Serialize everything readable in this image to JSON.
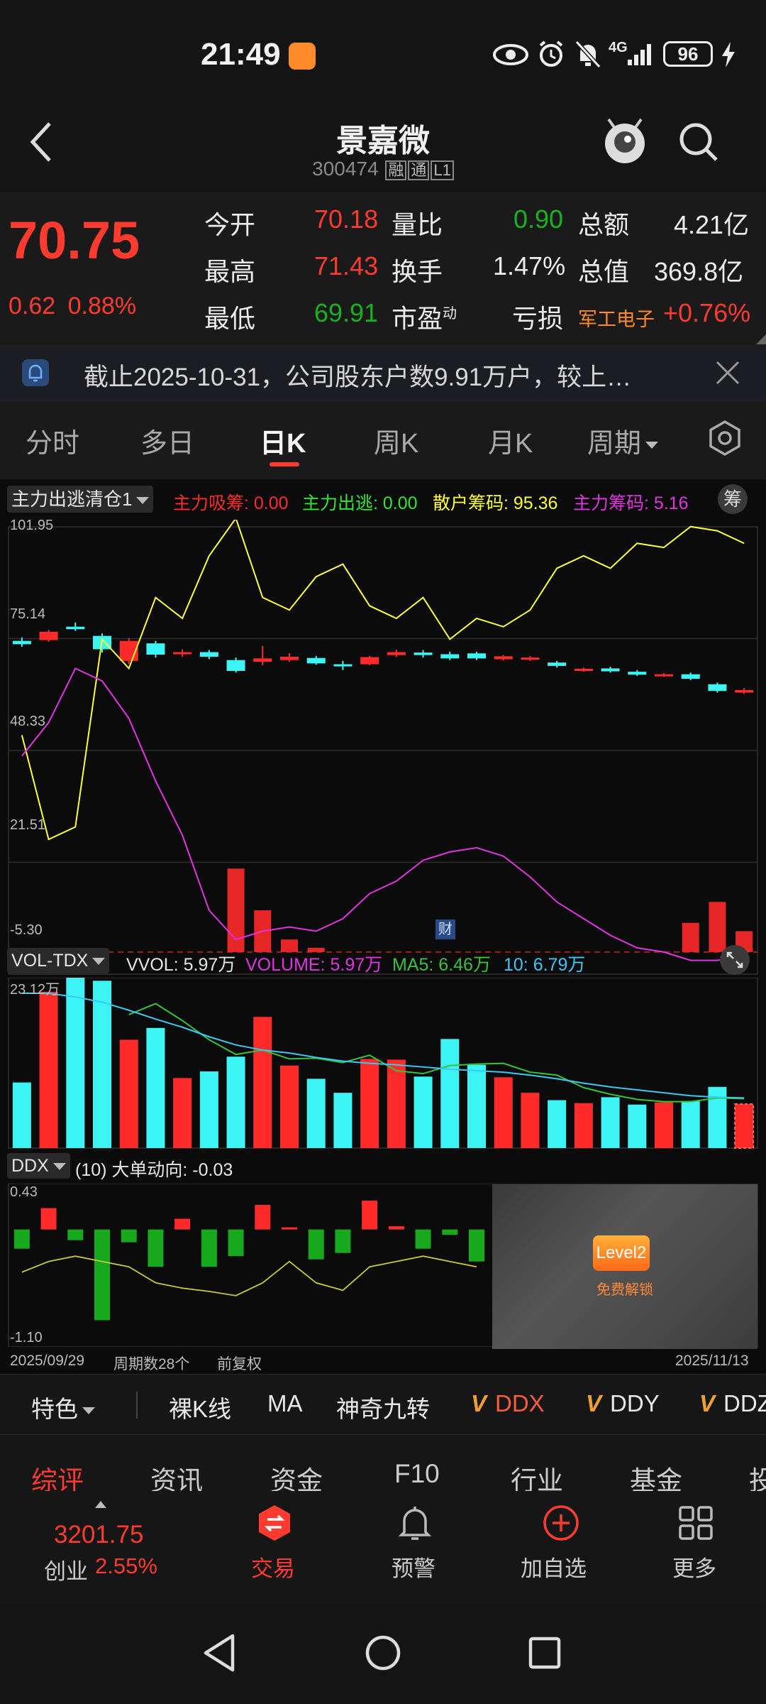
{
  "status_bar": {
    "time": "21:49",
    "network": "4G",
    "battery": "96"
  },
  "header": {
    "title": "景嘉微",
    "code": "300474",
    "badges": [
      "融",
      "通",
      "L1"
    ]
  },
  "quote": {
    "price": "70.75",
    "change": "0.62",
    "change_pct": "0.88%",
    "rows": [
      {
        "l1": "今开",
        "v1": "70.18",
        "l2": "量比",
        "v2": "0.90",
        "l3": "总额",
        "v3": "4.21亿"
      },
      {
        "l1": "最高",
        "v1": "71.43",
        "l2": "换手",
        "v2": "1.47%",
        "l3": "总值",
        "v3": "369.8亿"
      },
      {
        "l1": "最低",
        "v1": "69.91",
        "l2": "市盈",
        "l2_sup": "动",
        "v2": "亏损",
        "l3": "军工电子",
        "v3": "+0.76%"
      }
    ]
  },
  "notice": {
    "text": "截止2025-10-31，公司股东户数9.91万户，较上…"
  },
  "period_tabs": [
    "分时",
    "多日",
    "日K",
    "周K",
    "月K",
    "周期"
  ],
  "period_active": 2,
  "indicator": {
    "selector": "主力出逃清仓1",
    "items": [
      {
        "text": "主力吸筹: 0.00",
        "color": "#ff2a2a"
      },
      {
        "text": "主力出逃: 0.00",
        "color": "#2ee62e"
      },
      {
        "text": "散户筹码: 95.36",
        "color": "#ffff3a"
      },
      {
        "text": "主力筹码: 5.16",
        "color": "#e033e0"
      }
    ],
    "chou_label": "筹",
    "y_labels": [
      "101.95",
      "75.14",
      "48.33",
      "21.51",
      "-5.30"
    ],
    "cai_marker": "财"
  },
  "vol": {
    "selector": "VOL-TDX",
    "items": [
      {
        "text": "VVOL: 5.97万",
        "color": "#e6e6e6"
      },
      {
        "text": "VOLUME: 5.97万",
        "color": "#e033e0"
      },
      {
        "text": "MA5: 6.46万",
        "color": "#36c23a"
      },
      {
        "text": "10: 6.79万",
        "color": "#3bc8f5"
      }
    ],
    "y_label": "23.12万"
  },
  "ddx": {
    "selector": "DDX",
    "label": "(10) 大单动向: -0.03",
    "y_top": "0.43",
    "y_bottom": "-1.10",
    "level2_label": "Level2",
    "level2_sub": "免费解锁"
  },
  "footer_axis": {
    "start": "2025/09/29",
    "count": "周期数28个",
    "adjust": "前复权",
    "end": "2025/11/13"
  },
  "tools": [
    "特色",
    "裸K线",
    "MA",
    "神奇九转",
    "DDX",
    "DDY",
    "DDZ"
  ],
  "sub_tabs": [
    "综评",
    "资讯",
    "资金",
    "F10",
    "行业",
    "基金",
    "投"
  ],
  "bottom_nav": {
    "index_value": "3201.75",
    "index_name": "创业",
    "index_change": "2.55%",
    "items": [
      "交易",
      "预警",
      "加自选",
      "更多"
    ]
  },
  "colors": {
    "up": "#ff2a2a",
    "down": "#3cf4f4",
    "accent": "#ff3b30",
    "bg": "#141414"
  },
  "chart_data": [
    {
      "type": "candlestick",
      "y_ticks": [
        101.95,
        75.14,
        48.33,
        21.51,
        -5.3
      ],
      "candles": [
        {
          "o": 74.6,
          "c": 73.8,
          "h": 75.4,
          "l": 73.2
        },
        {
          "o": 74.8,
          "c": 76.8,
          "h": 77.2,
          "l": 74.4
        },
        {
          "o": 78.0,
          "c": 77.4,
          "h": 79.0,
          "l": 77.0
        },
        {
          "o": 75.8,
          "c": 72.6,
          "h": 76.4,
          "l": 71.8
        },
        {
          "o": 69.8,
          "c": 74.6,
          "h": 75.3,
          "l": 69.0
        },
        {
          "o": 74.0,
          "c": 71.3,
          "h": 74.6,
          "l": 70.6
        },
        {
          "o": 71.6,
          "c": 71.9,
          "h": 72.6,
          "l": 70.8
        },
        {
          "o": 71.9,
          "c": 70.8,
          "h": 72.4,
          "l": 70.2
        },
        {
          "o": 70.0,
          "c": 67.4,
          "h": 70.6,
          "l": 67.0
        },
        {
          "o": 69.6,
          "c": 70.4,
          "h": 73.4,
          "l": 68.8
        },
        {
          "o": 70.0,
          "c": 70.8,
          "h": 71.6,
          "l": 69.6
        },
        {
          "o": 70.5,
          "c": 69.2,
          "h": 71.0,
          "l": 68.9
        },
        {
          "o": 69.0,
          "c": 68.5,
          "h": 69.8,
          "l": 67.6
        },
        {
          "o": 69.0,
          "c": 70.7,
          "h": 71.0,
          "l": 68.8
        },
        {
          "o": 71.2,
          "c": 71.9,
          "h": 72.5,
          "l": 70.8
        },
        {
          "o": 71.8,
          "c": 71.2,
          "h": 72.4,
          "l": 70.6
        },
        {
          "o": 71.4,
          "c": 70.4,
          "h": 72.0,
          "l": 70.0
        },
        {
          "o": 71.6,
          "c": 70.4,
          "h": 72.0,
          "l": 70.0
        },
        {
          "o": 70.2,
          "c": 70.9,
          "h": 71.2,
          "l": 69.9
        },
        {
          "o": 70.1,
          "c": 70.6,
          "h": 71.0,
          "l": 69.8
        },
        {
          "o": 69.4,
          "c": 68.6,
          "h": 69.8,
          "l": 68.2
        },
        {
          "o": 67.6,
          "c": 67.9,
          "h": 68.2,
          "l": 67.2
        },
        {
          "o": 68.0,
          "c": 67.3,
          "h": 68.4,
          "l": 67.0
        },
        {
          "o": 67.2,
          "c": 66.5,
          "h": 67.6,
          "l": 66.2
        },
        {
          "o": 66.4,
          "c": 66.6,
          "h": 66.9,
          "l": 66.0
        },
        {
          "o": 66.6,
          "c": 65.5,
          "h": 67.0,
          "l": 65.2
        },
        {
          "o": 64.2,
          "c": 62.6,
          "h": 64.6,
          "l": 62.2
        },
        {
          "o": 62.2,
          "c": 62.8,
          "h": 63.3,
          "l": 61.9
        }
      ],
      "series": [
        {
          "name": "散户筹码",
          "color": "#ffff3a",
          "values": [
            52,
            27,
            30,
            75,
            68,
            85,
            80,
            95,
            104,
            85,
            82,
            90,
            93,
            83,
            80,
            85,
            75,
            80,
            78,
            82,
            92,
            95,
            92,
            98,
            97,
            102,
            101,
            98
          ]
        },
        {
          "name": "主力筹码",
          "color": "#e033e0",
          "values": [
            47,
            55,
            68,
            65,
            56,
            41,
            28,
            10,
            3,
            5,
            6,
            5,
            8,
            14,
            17,
            22,
            24,
            25,
            23,
            18,
            12,
            8,
            4,
            1,
            0,
            -2,
            -2,
            -1
          ]
        },
        {
          "name": "主力吸筹",
          "color": "#ff2a2a",
          "type": "bar",
          "values": [
            0,
            0,
            0,
            0,
            0,
            0,
            0,
            0,
            20,
            10,
            3,
            1,
            0,
            0,
            0,
            0,
            0,
            0,
            0,
            0,
            0,
            0,
            0,
            0,
            0,
            7,
            12,
            5
          ]
        }
      ]
    },
    {
      "type": "bar",
      "title": "VOL-TDX",
      "ylim": [
        0,
        23.12
      ],
      "values": [
        8.9,
        21.2,
        23.12,
        22.7,
        14.7,
        16.3,
        9.5,
        10.4,
        12.4,
        17.8,
        11.2,
        9.4,
        7.5,
        12.1,
        12.0,
        9.7,
        14.8,
        11.3,
        9.6,
        7.5,
        6.5,
        6.1,
        6.9,
        5.9,
        6.2,
        6.4,
        8.3,
        5.97
      ],
      "direction": [
        "down",
        "up",
        "down",
        "down",
        "up",
        "down",
        "up",
        "down",
        "down",
        "up",
        "up",
        "down",
        "down",
        "up",
        "up",
        "down",
        "down",
        "down",
        "up",
        "up",
        "down",
        "up",
        "down",
        "down",
        "up",
        "down",
        "down",
        "up"
      ],
      "series": [
        {
          "name": "MA5",
          "color": "#36c23a",
          "values": [
            null,
            null,
            null,
            null,
            18.1,
            19.6,
            17.3,
            14.7,
            12.7,
            13.3,
            12.1,
            12.2,
            11.6,
            12.6,
            10.5,
            10.1,
            11.2,
            11.4,
            11.5,
            10.3,
            9.9,
            8.2,
            7.3,
            6.6,
            6.3,
            6.3,
            6.8,
            6.7
          ]
        },
        {
          "name": "10",
          "color": "#3bc8f5",
          "values": [
            21.0,
            21.0,
            20.5,
            19.8,
            18.7,
            17.5,
            16.4,
            15.1,
            14.0,
            13.3,
            12.9,
            12.3,
            11.8,
            11.5,
            11.3,
            11.0,
            10.7,
            10.5,
            10.3,
            9.9,
            9.4,
            8.8,
            8.3,
            7.9,
            7.5,
            7.1,
            6.9,
            6.8
          ]
        }
      ]
    },
    {
      "type": "bar",
      "title": "DDX",
      "ylim": [
        -1.1,
        0.43
      ],
      "values": [
        -0.18,
        0.2,
        -0.1,
        -0.85,
        -0.12,
        -0.35,
        0.1,
        -0.35,
        -0.25,
        0.23,
        0.02,
        -0.28,
        -0.22,
        0.27,
        0.03,
        -0.18,
        -0.05,
        -0.3
      ],
      "series": [
        {
          "name": "均线",
          "color": "#c8c93a",
          "values": [
            -0.4,
            -0.3,
            -0.25,
            -0.3,
            -0.35,
            -0.5,
            -0.55,
            -0.58,
            -0.62,
            -0.5,
            -0.3,
            -0.5,
            -0.57,
            -0.35,
            -0.3,
            -0.25,
            -0.3,
            -0.35
          ]
        }
      ]
    }
  ]
}
